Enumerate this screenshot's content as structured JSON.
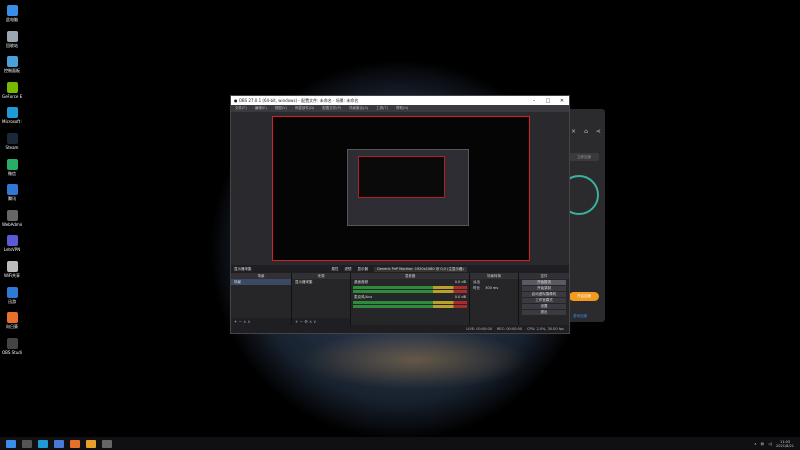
{
  "desktop": {
    "icons": [
      {
        "label": "此电脑",
        "color": "#3b8ee8"
      },
      {
        "label": "回收站",
        "color": "#9aa7b3"
      },
      {
        "label": "控制面板",
        "color": "#4aa0d8"
      },
      {
        "label": "GeForce Experience",
        "color": "#76b900"
      },
      {
        "label": "Microsoft Edge",
        "color": "#1e9ad6"
      },
      {
        "label": "Steam",
        "color": "#1b2838"
      },
      {
        "label": "微信",
        "color": "#2aae67"
      },
      {
        "label": "腾讯",
        "color": "#3178d6"
      },
      {
        "label": "WebAdmin",
        "color": "#666"
      },
      {
        "label": "LetsVPN",
        "color": "#5a5ad6"
      },
      {
        "label": "WiFi共享",
        "color": "#bbb"
      },
      {
        "label": "迅游",
        "color": "#2e7bd6"
      },
      {
        "label": "向日葵",
        "color": "#e8702a"
      },
      {
        "label": "OBS Studio",
        "color": "#444"
      }
    ]
  },
  "obs": {
    "title": "OBS 27.0.1 (64-bit, windows) - 配置文件: 未命名 - 场景: 未命名",
    "menu": [
      "文件(F)",
      "编辑(E)",
      "视图(V)",
      "停靠部件(D)",
      "配置文件(P)",
      "场景集合(S)",
      "工具(T)",
      "帮助(H)"
    ],
    "dock_header": {
      "scene_label": "显示器采集",
      "props_label": "属性",
      "filters_label": "滤镜",
      "display_label": "显示器",
      "display_value": "Generic PnP Monitor: 1920x1080 @ 0,0 (主显示器)"
    },
    "scenes": {
      "title": "场景",
      "items": [
        "场景"
      ],
      "footer": "+ −  ∧ ∨"
    },
    "sources": {
      "title": "来源",
      "items": [
        "显示器采集"
      ],
      "footer": "+ −  ⚙ ∧ ∨"
    },
    "mixer": {
      "title": "混音器",
      "tracks": [
        {
          "name": "桌面音频",
          "level": "0.0 dB"
        },
        {
          "name": "麦克风/Aux",
          "level": "0.0 dB"
        }
      ]
    },
    "transitions": {
      "title": "场景转换",
      "type": "淡出",
      "duration_label": "时长",
      "duration": "300 ms"
    },
    "controls": {
      "title": "控件",
      "buttons": [
        "开始推流",
        "开始录制",
        "启动虚拟摄像机",
        "工作室模式",
        "设置",
        "退出"
      ]
    },
    "status": {
      "live": "LIVE: 00:00:00",
      "rec": "REC: 00:00:00",
      "cpu": "CPU: 2.0%, 30.00 fps"
    }
  },
  "side_app": {
    "pill": "立即加速",
    "button": "开启加速",
    "link": "游戏加速"
  },
  "taskbar": {
    "time": "11:03",
    "date": "2021/8/21"
  }
}
